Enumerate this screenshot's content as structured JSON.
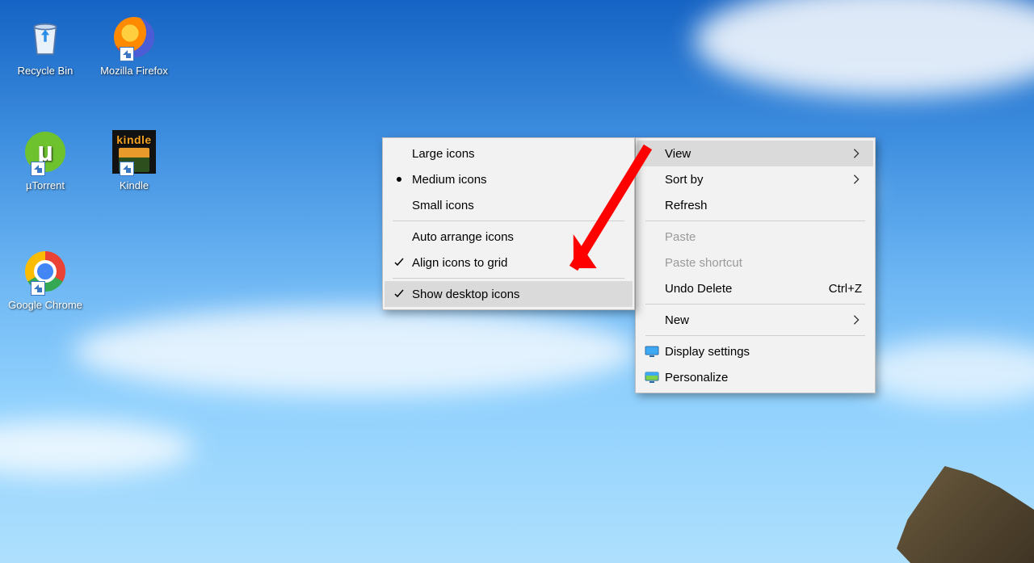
{
  "desktop": {
    "icons": [
      {
        "key": "recycle-bin",
        "label": "Recycle Bin",
        "shortcut": false
      },
      {
        "key": "firefox",
        "label": "Mozilla Firefox",
        "shortcut": true
      },
      {
        "key": "utorrent",
        "label": "µTorrent",
        "shortcut": true
      },
      {
        "key": "kindle",
        "label": "Kindle",
        "shortcut": true
      },
      {
        "key": "chrome",
        "label": "Google Chrome",
        "shortcut": true
      }
    ]
  },
  "context_menu": {
    "items": [
      {
        "label": "View",
        "submenu": true,
        "highlighted": true
      },
      {
        "label": "Sort by",
        "submenu": true
      },
      {
        "label": "Refresh"
      },
      {
        "separator": true
      },
      {
        "label": "Paste",
        "disabled": true
      },
      {
        "label": "Paste shortcut",
        "disabled": true
      },
      {
        "label": "Undo Delete",
        "shortcut": "Ctrl+Z"
      },
      {
        "separator": true
      },
      {
        "label": "New",
        "submenu": true
      },
      {
        "separator": true
      },
      {
        "label": "Display settings",
        "icon": "display"
      },
      {
        "label": "Personalize",
        "icon": "personalize"
      }
    ]
  },
  "view_submenu": {
    "items": [
      {
        "label": "Large icons"
      },
      {
        "label": "Medium icons",
        "radio": true
      },
      {
        "label": "Small icons"
      },
      {
        "separator": true
      },
      {
        "label": "Auto arrange icons"
      },
      {
        "label": "Align icons to grid",
        "checked": true
      },
      {
        "separator": true
      },
      {
        "label": "Show desktop icons",
        "checked": true,
        "highlighted": true
      }
    ]
  },
  "annotation": {
    "color": "#ff0000"
  }
}
